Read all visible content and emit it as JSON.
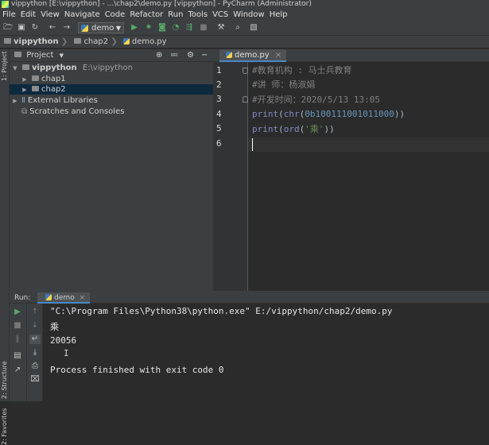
{
  "window": {
    "title": "vippython [E:\\vippython] - ...\\chap2\\demo.py [vippython] - PyCharm (Administrator)"
  },
  "menu": [
    "File",
    "Edit",
    "View",
    "Navigate",
    "Code",
    "Refactor",
    "Run",
    "Tools",
    "VCS",
    "Window",
    "Help"
  ],
  "toolbar": {
    "run_config": "demo"
  },
  "breadcrumb": [
    "vippython",
    "chap2",
    "demo.py"
  ],
  "left_stripe": {
    "project_label": "1: Project",
    "structure_label": "2: Structure",
    "favorites_label": "2: Favorites"
  },
  "project": {
    "header": "Project",
    "tree": [
      {
        "label": "vippython",
        "path": "E:\\vippython"
      },
      {
        "label": "chap1"
      },
      {
        "label": "chap2"
      },
      {
        "label": "External Libraries"
      },
      {
        "label": "Scratches and Consoles"
      }
    ]
  },
  "editor": {
    "tab": "demo.py",
    "line_numbers": [
      "1",
      "2",
      "3",
      "4",
      "5",
      "6"
    ],
    "code": {
      "l1": "#教育机构 : 马士兵教育",
      "l2": "#讲    师：杨淑娟",
      "l3": "#开发时间：2020/5/13 13:05",
      "l4": {
        "fn1": "print",
        "p1": "(",
        "fn2": "chr",
        "p2": "(",
        "num": "0b100111001011000",
        "p3": "))"
      },
      "l5": {
        "fn1": "print",
        "p1": "(",
        "fn2": "ord",
        "p2": "(",
        "str": "'乘'",
        "p3": "))"
      }
    }
  },
  "run": {
    "label": "Run:",
    "tab": "demo",
    "console": [
      "\"C:\\Program Files\\Python38\\python.exe\" E:/vippython/chap2/demo.py",
      "乘",
      "20056",
      "Process finished with exit code 0"
    ]
  },
  "colors": {
    "background": "#2b2b2b",
    "panel": "#3c3f41",
    "comment": "#808080",
    "builtin": "#8888c6",
    "number": "#6897bb",
    "string": "#6a8759",
    "selection": "#0d293e"
  }
}
